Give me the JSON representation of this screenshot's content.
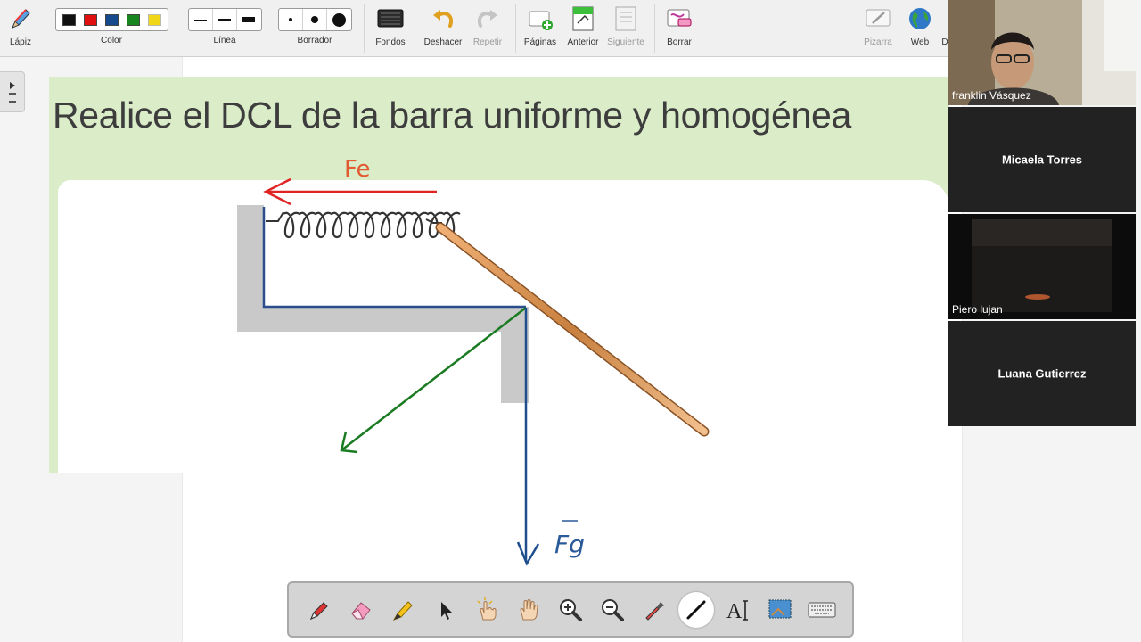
{
  "toolbar": {
    "lapiz": "Lápiz",
    "color": "Color",
    "linea": "Línea",
    "borrador": "Borrador",
    "fondos": "Fondos",
    "deshacer": "Deshacer",
    "repetir": "Repetir",
    "paginas": "Páginas",
    "anterior": "Anterior",
    "siguiente": "Siguiente",
    "borrar": "Borrar",
    "pizarra": "Pizarra",
    "web": "Web",
    "cut_label": "D",
    "colors": [
      "#111111",
      "#e01010",
      "#174a8c",
      "#18861e",
      "#f0d818"
    ]
  },
  "slide": {
    "title": "Realice el DCL de la barra uniforme y homogénea",
    "label_fe": "Fe",
    "label_fg": "Fg"
  },
  "participants": [
    {
      "name": "franklin Vásquez",
      "video": true
    },
    {
      "name": "Micaela Torres",
      "video": false
    },
    {
      "name": "Piero lujan",
      "video": true
    },
    {
      "name": "Luana Gutierrez",
      "video": false
    }
  ],
  "palette": {
    "tools": [
      "pen",
      "eraser",
      "highlighter",
      "pointer",
      "click",
      "pan",
      "zoom-in",
      "zoom-out",
      "eyedropper",
      "line",
      "text",
      "screenshot",
      "keyboard"
    ],
    "active": "line"
  }
}
